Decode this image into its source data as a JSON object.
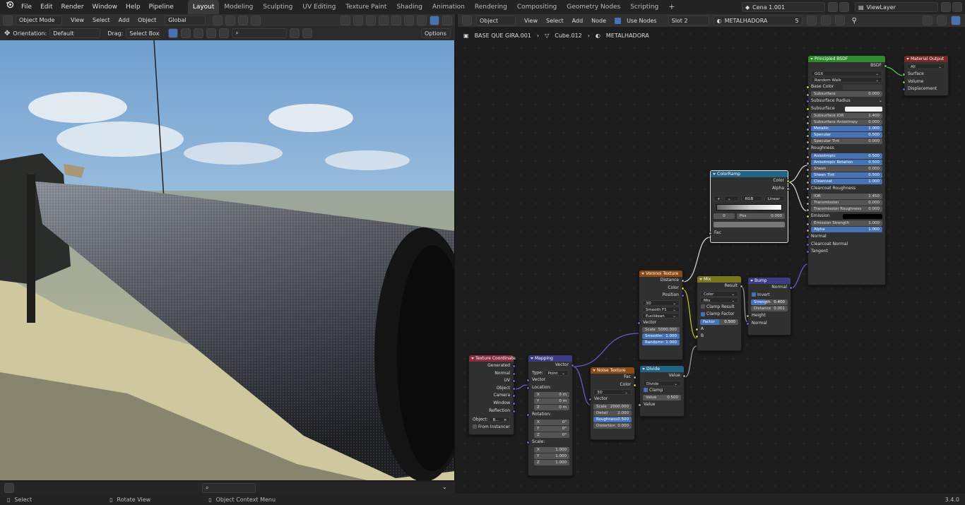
{
  "menu": {
    "items": [
      "File",
      "Edit",
      "Render",
      "Window",
      "Help",
      "Pipeline"
    ]
  },
  "workspaces": [
    "Layout",
    "Modeling",
    "Sculpting",
    "UV Editing",
    "Texture Paint",
    "Shading",
    "Animation",
    "Rendering",
    "Compositing",
    "Geometry Nodes",
    "Scripting"
  ],
  "active_workspace": "Layout",
  "scene": {
    "name": "Cena 1.001",
    "viewlayer": "ViewLayer"
  },
  "viewport": {
    "mode": "Object Mode",
    "menus": [
      "View",
      "Select",
      "Add",
      "Object"
    ],
    "transform": "Global",
    "orientation_label": "Orientation:",
    "orientation": "Default",
    "drag_label": "Drag:",
    "drag": "Select Box",
    "options": "Options"
  },
  "node_editor": {
    "type": "Object",
    "menus": [
      "View",
      "Select",
      "Add",
      "Node"
    ],
    "use_nodes": "Use Nodes",
    "slot": "Slot 2",
    "material": "METALHADORA",
    "users": "5",
    "breadcrumb": [
      "BASE QUE GIRA.001",
      "Cube.012",
      "METALHADORA"
    ]
  },
  "status": {
    "select": "Select",
    "rotate": "Rotate View",
    "context": "Object Context Menu",
    "version": "3.4.0"
  },
  "nodes": {
    "texcoord": {
      "title": "Texture Coordinate",
      "outputs": [
        "Generated",
        "Normal",
        "UV",
        "Object",
        "Camera",
        "Window",
        "Reflection"
      ],
      "object_label": "Object:",
      "object": "B...",
      "instancer": "From Instancer"
    },
    "mapping": {
      "title": "Mapping",
      "out": "Vector",
      "type_label": "Type:",
      "type": "Point",
      "vector": "Vector",
      "loc": "Location:",
      "rot": "Rotation:",
      "scale": "Scale:",
      "location": [
        [
          "X",
          "0 m"
        ],
        [
          "Y",
          "0 m"
        ],
        [
          "Z",
          "0 m"
        ]
      ],
      "rotation": [
        [
          "X",
          "0°"
        ],
        [
          "Y",
          "0°"
        ],
        [
          "Z",
          "0°"
        ]
      ],
      "scalev": [
        [
          "X",
          "1.000"
        ],
        [
          "Y",
          "1.000"
        ],
        [
          "Z",
          "1.000"
        ]
      ]
    },
    "noise": {
      "title": "Noise Texture",
      "outputs": [
        "Fac",
        "Color"
      ],
      "dim": "3D",
      "vector": "Vector",
      "fields": [
        [
          "Scale",
          "2000.000"
        ],
        [
          "Detail",
          "2.000"
        ],
        [
          "Roughness",
          "0.500"
        ],
        [
          "Distortion",
          "0.000"
        ]
      ]
    },
    "voronoi": {
      "title": "Voronoi Texture",
      "outputs": [
        "Distance",
        "Color",
        "Position"
      ],
      "dim": "3D",
      "feature": "Smooth F1",
      "metric": "Euclidean",
      "vector": "Vector",
      "fields": [
        [
          "Scale",
          "5000.000"
        ],
        [
          "Smoothn",
          "1.000"
        ],
        [
          "Randomn",
          "1.000"
        ]
      ]
    },
    "divide": {
      "title": "Divide",
      "out": "Value",
      "op": "Divide",
      "clamp": "Clamp",
      "fields": [
        [
          "Value",
          "0.500"
        ]
      ],
      "in": "Value"
    },
    "mix": {
      "title": "Mix",
      "out": "Result",
      "type": "Color",
      "blend": "Mix",
      "clamp_result": "Clamp Result",
      "clamp_factor": "Clamp Factor",
      "factor": [
        "Factor",
        "0.500"
      ],
      "a": "A",
      "b": "B"
    },
    "bump": {
      "title": "Bump",
      "out": "Normal",
      "invert": "Invert",
      "fields": [
        [
          "Strength",
          "0.400"
        ],
        [
          "Distance",
          "0.001"
        ]
      ],
      "height": "Height",
      "normal": "Normal"
    },
    "colorramp": {
      "title": "ColorRamp",
      "outputs": [
        "Color",
        "Alpha"
      ],
      "mode": "RGB",
      "interp": "Linear",
      "index": "0",
      "pos_label": "Pos",
      "pos": "0.000",
      "fac": "Fac"
    },
    "bsdf": {
      "title": "Principled BSDF",
      "out": "BSDF",
      "dist": "GGX",
      "sss": "Random Walk",
      "rows": [
        [
          "Base Color",
          ""
        ],
        [
          "Subsurface",
          "0.000"
        ],
        [
          "Subsurface Radius",
          ""
        ],
        [
          "Subsurface Color",
          ""
        ],
        [
          "Subsurface IOR",
          "1.400"
        ],
        [
          "Subsurface Anisotropy",
          "0.000"
        ],
        [
          "Metallic",
          "1.000"
        ],
        [
          "Specular",
          "0.500"
        ],
        [
          "Specular Tint",
          "0.000"
        ],
        [
          "Roughness",
          ""
        ],
        [
          "Anisotropic",
          "0.500"
        ],
        [
          "Anisotropic Rotation",
          "0.500"
        ],
        [
          "Sheen",
          "0.000"
        ],
        [
          "Sheen Tint",
          "0.500"
        ],
        [
          "Clearcoat",
          "1.000"
        ],
        [
          "Clearcoat Roughness",
          ""
        ],
        [
          "IOR",
          "1.450"
        ],
        [
          "Transmission",
          "0.000"
        ],
        [
          "Transmission Roughness",
          "0.000"
        ],
        [
          "Emission",
          ""
        ],
        [
          "Emission Strength",
          "1.000"
        ],
        [
          "Alpha",
          "1.000"
        ],
        [
          "Normal",
          ""
        ],
        [
          "Clearcoat Normal",
          ""
        ],
        [
          "Tangent",
          ""
        ]
      ]
    },
    "output": {
      "title": "Material Output",
      "target": "All",
      "inputs": [
        "Surface",
        "Volume",
        "Displacement"
      ]
    }
  },
  "colors": {
    "accent": "#4772b3",
    "tex_header": "#8a2b44",
    "vec_header": "#3c3c83",
    "texture_header": "#8a4b17",
    "conv_header": "#246283",
    "mix_header": "#79761f",
    "shader_header": "#2d8a2d",
    "output_header": "#792828"
  }
}
